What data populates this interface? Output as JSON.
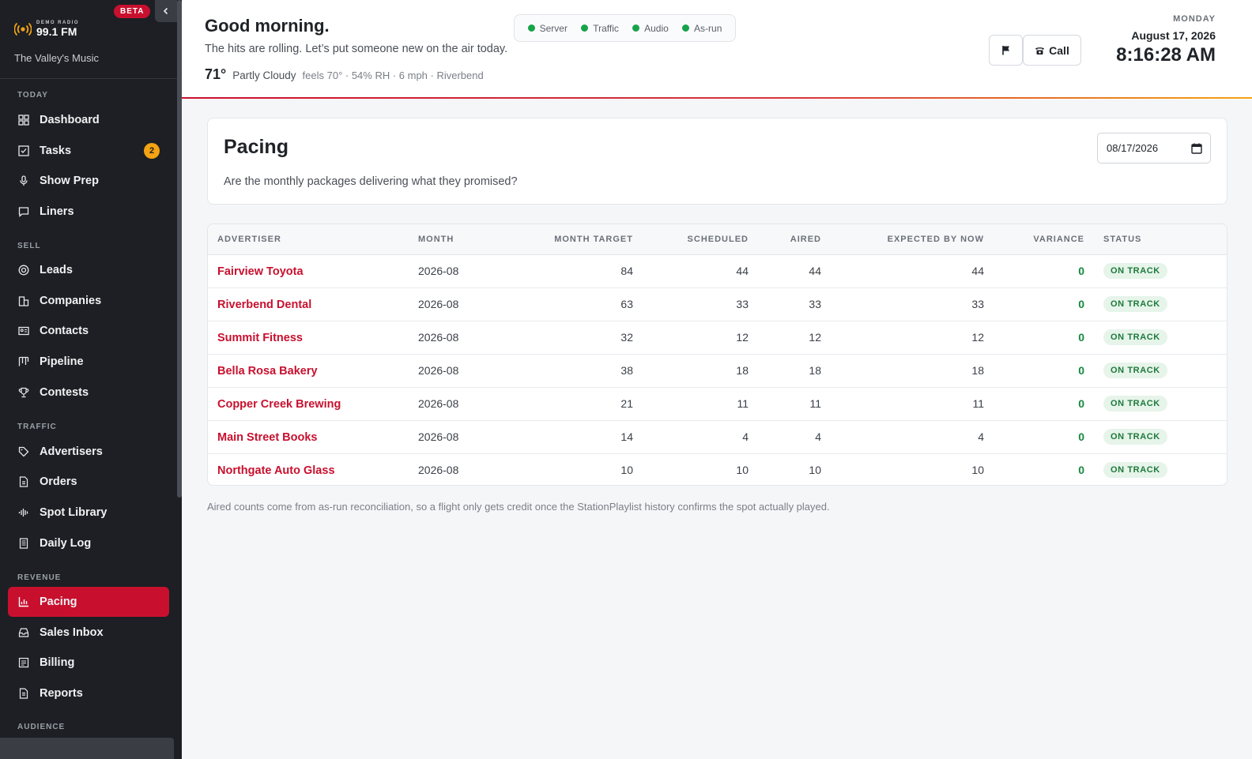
{
  "brand": {
    "top_text": "DEMO RADIO",
    "station": "99.1 FM",
    "tagline": "The Valley's Music",
    "beta": "BETA",
    "accent": "#c8102e"
  },
  "nav": {
    "sections": {
      "today": "TODAY",
      "sell": "SELL",
      "traffic": "TRAFFIC",
      "revenue": "REVENUE",
      "audience": "AUDIENCE"
    },
    "items": {
      "dashboard": "Dashboard",
      "tasks": "Tasks",
      "tasks_badge": "2",
      "show_prep": "Show Prep",
      "liners": "Liners",
      "leads": "Leads",
      "companies": "Companies",
      "contacts": "Contacts",
      "pipeline": "Pipeline",
      "contests": "Contests",
      "advertisers": "Advertisers",
      "orders": "Orders",
      "spot_library": "Spot Library",
      "daily_log": "Daily Log",
      "pacing": "Pacing",
      "sales_inbox": "Sales Inbox",
      "billing": "Billing",
      "reports": "Reports"
    }
  },
  "header": {
    "greeting": "Good morning.",
    "subtitle": "The hits are rolling. Let’s put someone new on the air today.",
    "weather": {
      "temp": "71°",
      "condition": "Partly Cloudy",
      "details": "feels 70° · 54% RH · 6 mph · Riverbend"
    },
    "status": {
      "server": "Server",
      "traffic": "Traffic",
      "audio": "Audio",
      "asrun": "As-run"
    },
    "call_label": "Call",
    "day": "MONDAY",
    "date": "August 17, 2026",
    "time": "8:16:28 AM"
  },
  "pacing": {
    "title": "Pacing",
    "subtitle": "Are the monthly packages delivering what they promised?",
    "date_value": "08/17/2026",
    "columns": {
      "advertiser": "ADVERTISER",
      "month": "MONTH",
      "target": "MONTH TARGET",
      "scheduled": "SCHEDULED",
      "aired": "AIRED",
      "expected": "EXPECTED BY NOW",
      "variance": "VARIANCE",
      "status": "STATUS"
    },
    "rows": [
      {
        "advertiser": "Fairview Toyota",
        "month": "2026-08",
        "target": "84",
        "scheduled": "44",
        "aired": "44",
        "expected": "44",
        "variance": "0",
        "status": "ON TRACK"
      },
      {
        "advertiser": "Riverbend Dental",
        "month": "2026-08",
        "target": "63",
        "scheduled": "33",
        "aired": "33",
        "expected": "33",
        "variance": "0",
        "status": "ON TRACK"
      },
      {
        "advertiser": "Summit Fitness",
        "month": "2026-08",
        "target": "32",
        "scheduled": "12",
        "aired": "12",
        "expected": "12",
        "variance": "0",
        "status": "ON TRACK"
      },
      {
        "advertiser": "Bella Rosa Bakery",
        "month": "2026-08",
        "target": "38",
        "scheduled": "18",
        "aired": "18",
        "expected": "18",
        "variance": "0",
        "status": "ON TRACK"
      },
      {
        "advertiser": "Copper Creek Brewing",
        "month": "2026-08",
        "target": "21",
        "scheduled": "11",
        "aired": "11",
        "expected": "11",
        "variance": "0",
        "status": "ON TRACK"
      },
      {
        "advertiser": "Main Street Books",
        "month": "2026-08",
        "target": "14",
        "scheduled": "4",
        "aired": "4",
        "expected": "4",
        "variance": "0",
        "status": "ON TRACK"
      },
      {
        "advertiser": "Northgate Auto Glass",
        "month": "2026-08",
        "target": "10",
        "scheduled": "10",
        "aired": "10",
        "expected": "10",
        "variance": "0",
        "status": "ON TRACK"
      }
    ],
    "footnote": "Aired counts come from as-run reconciliation, so a flight only gets credit once the StationPlaylist history confirms the spot actually played."
  }
}
